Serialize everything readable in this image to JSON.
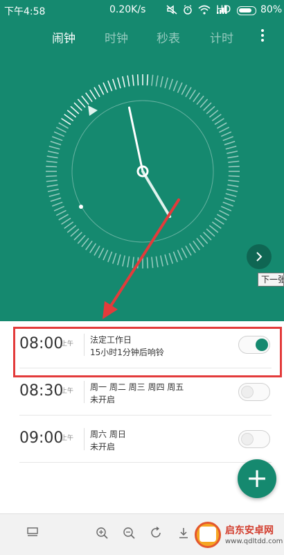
{
  "status_bar": {
    "time": "下午4:58",
    "speed": "0.20K/s",
    "network": "HD",
    "battery": "80%",
    "battery_level": 0.8
  },
  "tabs": [
    {
      "label": "闹钟",
      "active": true
    },
    {
      "label": "时钟",
      "active": false
    },
    {
      "label": "秒表",
      "active": false
    },
    {
      "label": "计时",
      "active": false
    }
  ],
  "clock": {
    "hour": 4,
    "minute": 58,
    "second": 0
  },
  "next_tooltip": "下一张",
  "alarms": [
    {
      "time": "08:00",
      "ampm": "上午",
      "line1": "法定工作日",
      "line2": "15小时1分钟后响铃",
      "enabled": true
    },
    {
      "time": "08:30",
      "ampm": "上午",
      "line1": "周一 周二 周三 周四 周五",
      "line2": "未开启",
      "enabled": false
    },
    {
      "time": "09:00",
      "ampm": "上午",
      "line1": "周六 周日",
      "line2": "未开启",
      "enabled": false
    }
  ],
  "fab_label": "+",
  "watermark": {
    "name": "启东安卓网",
    "url": "www.qdltdd.com"
  },
  "colors": {
    "primary": "#15896f",
    "annotation": "#e33b3b"
  }
}
